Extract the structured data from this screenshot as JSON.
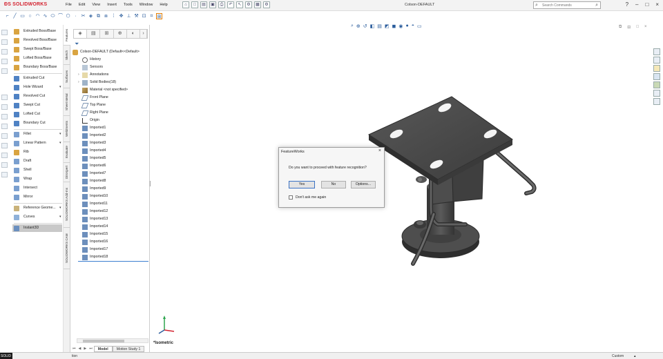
{
  "app": {
    "logo_text": "SOLIDWORKS",
    "menus": [
      "File",
      "Edit",
      "View",
      "Insert",
      "Tools",
      "Window",
      "Help"
    ],
    "document_title": "Colson-DEFAULT",
    "search_placeholder": "Search Commands",
    "window_buttons": [
      "minimize-icon",
      "restore-icon",
      "close-icon"
    ]
  },
  "command_panel": {
    "items": [
      {
        "label": "Extruded Boss/Base",
        "icon": "extrude-boss-icon"
      },
      {
        "label": "Revolved Boss/Base",
        "icon": "revolve-boss-icon"
      },
      {
        "label": "Swept Boss/Base",
        "icon": "sweep-boss-icon"
      },
      {
        "label": "Lofted Boss/Base",
        "icon": "loft-boss-icon"
      },
      {
        "label": "Boundary Boss/Base",
        "icon": "boundary-boss-icon"
      },
      {
        "label": "Extruded Cut",
        "icon": "extrude-cut-icon"
      },
      {
        "label": "Hole Wizard",
        "icon": "hole-wizard-icon"
      },
      {
        "label": "Revolved Cut",
        "icon": "revolve-cut-icon"
      },
      {
        "label": "Swept Cut",
        "icon": "swept-cut-icon"
      },
      {
        "label": "Lofted Cut",
        "icon": "lofted-cut-icon"
      },
      {
        "label": "Boundary Cut",
        "icon": "boundary-cut-icon"
      },
      {
        "label": "Fillet",
        "icon": "fillet-icon"
      },
      {
        "label": "Linear Pattern",
        "icon": "linear-pattern-icon"
      },
      {
        "label": "Rib",
        "icon": "rib-icon"
      },
      {
        "label": "Draft",
        "icon": "draft-icon"
      },
      {
        "label": "Shell",
        "icon": "shell-icon"
      },
      {
        "label": "Wrap",
        "icon": "wrap-icon"
      },
      {
        "label": "Intersect",
        "icon": "intersect-icon"
      },
      {
        "label": "Mirror",
        "icon": "mirror-icon"
      },
      {
        "label": "Reference Geome...",
        "icon": "reference-geometry-icon"
      },
      {
        "label": "Curves",
        "icon": "curves-icon"
      },
      {
        "label": "Instant3D",
        "icon": "instant3d-icon"
      }
    ]
  },
  "vertical_tabs": [
    "Features",
    "Sketch",
    "Surfaces",
    "Sheet Metal",
    "Weldments",
    "Evaluate",
    "DimXpert",
    "SOLIDWORKS Add-Ins",
    "SOLIDWORKS CAM"
  ],
  "feature_tree": {
    "root": "Colson-DEFAULT  (Default<<Default>",
    "items": [
      {
        "label": "History",
        "expandable": false
      },
      {
        "label": "Sensors",
        "expandable": false
      },
      {
        "label": "Annotations",
        "expandable": true
      },
      {
        "label": "Solid Bodies(18)",
        "expandable": true
      },
      {
        "label": "Material <not specified>",
        "expandable": false
      },
      {
        "label": "Front Plane",
        "expandable": false
      },
      {
        "label": "Top Plane",
        "expandable": false
      },
      {
        "label": "Right Plane",
        "expandable": false
      },
      {
        "label": "Origin",
        "expandable": false
      },
      {
        "label": "Imported1",
        "expandable": false
      },
      {
        "label": "Imported2",
        "expandable": false
      },
      {
        "label": "Imported3",
        "expandable": false
      },
      {
        "label": "Imported4",
        "expandable": false
      },
      {
        "label": "Imported5",
        "expandable": false
      },
      {
        "label": "Imported6",
        "expandable": false
      },
      {
        "label": "Imported7",
        "expandable": false
      },
      {
        "label": "Imported8",
        "expandable": false
      },
      {
        "label": "Imported9",
        "expandable": false
      },
      {
        "label": "Imported10",
        "expandable": false
      },
      {
        "label": "Imported11",
        "expandable": false
      },
      {
        "label": "Imported12",
        "expandable": false
      },
      {
        "label": "Imported13",
        "expandable": false
      },
      {
        "label": "Imported14",
        "expandable": false
      },
      {
        "label": "Imported15",
        "expandable": false
      },
      {
        "label": "Imported16",
        "expandable": false
      },
      {
        "label": "Imported17",
        "expandable": false
      },
      {
        "label": "Imported18",
        "expandable": false
      }
    ]
  },
  "bottom_tabs": {
    "model": "Model",
    "motion": "Motion Study 1"
  },
  "graphics": {
    "view_name": "*Isometric"
  },
  "dialog": {
    "title": "FeatureWorks",
    "message": "Do you want to proceed with feature recognition?",
    "buttons": {
      "yes": "Yes",
      "no": "No",
      "options": "Options..."
    },
    "checkbox_label": "Don't ask me again"
  },
  "status": {
    "left": "SOLID",
    "text": "tion",
    "units": "Custom"
  },
  "colors": {
    "brand": "#d3212e",
    "accent": "#3a72c4",
    "model_gray": "#4a4a4a"
  }
}
